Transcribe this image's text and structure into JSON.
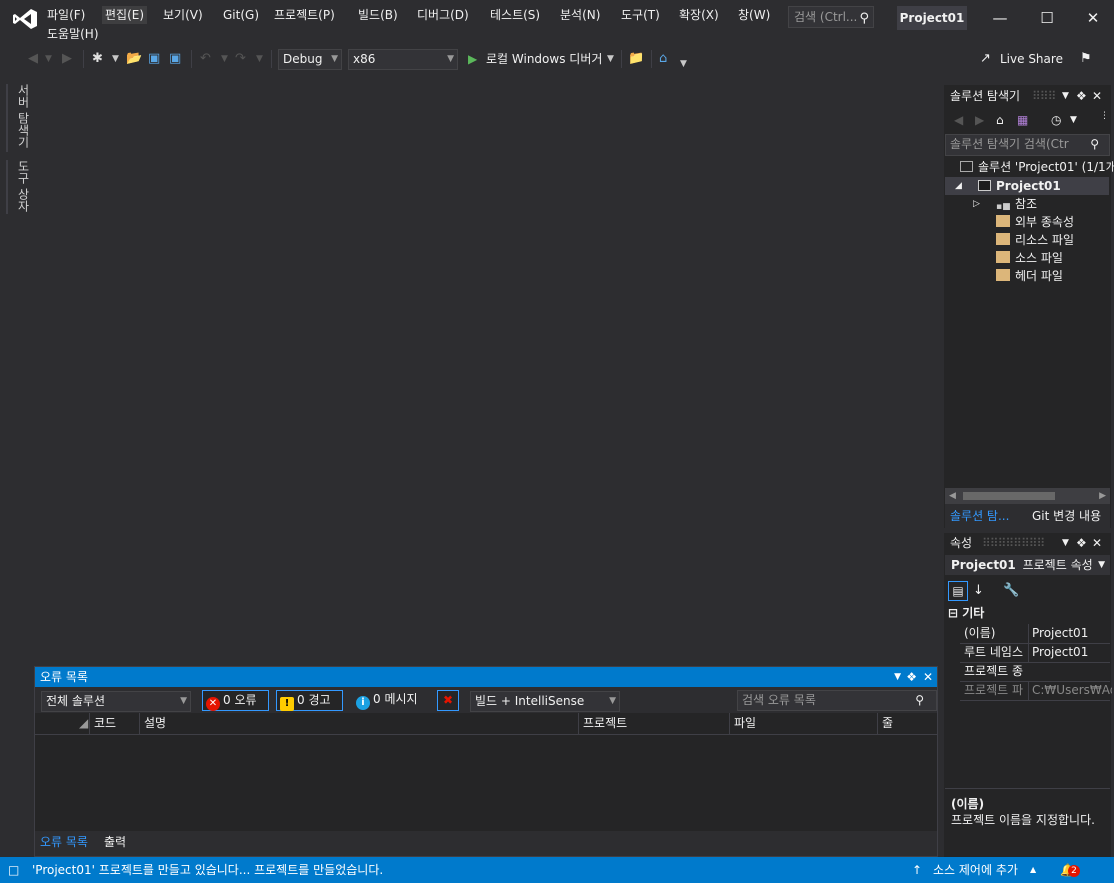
{
  "menu": {
    "items": [
      "파일(F)",
      "편집(E)",
      "보기(V)",
      "Git(G)",
      "프로젝트(P)",
      "빌드(B)",
      "디버그(D)",
      "테스트(S)",
      "분석(N)",
      "도구(T)",
      "확장(X)",
      "창(W)",
      "도움말(H)"
    ],
    "search_placeholder": "검색 (Ctrl...",
    "project_title": "Project01"
  },
  "toolbar": {
    "config": "Debug",
    "platform": "x86",
    "run_label": "로컬 Windows 디버거",
    "live_share": "Live Share"
  },
  "left_tabs": [
    "서버 탐색기",
    "도구 상자"
  ],
  "error_list": {
    "title": "오류 목록",
    "scope": "전체 솔루션",
    "errors": "0 오류",
    "warnings": "0 경고",
    "messages": "0 메시지",
    "source": "빌드 + IntelliSense",
    "search_placeholder": "검색 오류 목록",
    "columns": [
      "코드",
      "설명",
      "프로젝트",
      "파일",
      "줄"
    ],
    "bottom_tabs": [
      "오류 목록",
      "출력"
    ]
  },
  "solution_explorer": {
    "title": "솔루션 탐색기",
    "search_placeholder": "솔루션 탐색기 검색(Ctr",
    "solution": "솔루션 'Project01' (1/1개",
    "project": "Project01",
    "nodes": [
      "참조",
      "외부 종속성",
      "리소스 파일",
      "소스 파일",
      "헤더 파일"
    ],
    "tabs": [
      "솔루션 탐...",
      "Git 변경 내용"
    ]
  },
  "properties": {
    "title": "속성",
    "object": "Project01",
    "object_type": "프로젝트 속성",
    "category": "기타",
    "rows": [
      {
        "name": "(이름)",
        "value": "Project01"
      },
      {
        "name": "루트 네임스",
        "value": "Project01"
      },
      {
        "name": "프로젝트 종",
        "value": ""
      },
      {
        "name": "프로젝트 파",
        "value": "C:₩Users₩Adm"
      }
    ],
    "desc_title": "(이름)",
    "desc_text": "프로젝트 이름을 지정합니다."
  },
  "status": {
    "message": "'Project01' 프로젝트를 만들고 있습니다... 프로젝트를 만들었습니다.",
    "source_control": "소스 제어에 추가",
    "notifications": "2"
  },
  "colors": {
    "accent": "#007acc",
    "bg": "#2d2d30",
    "panel": "#252526"
  }
}
